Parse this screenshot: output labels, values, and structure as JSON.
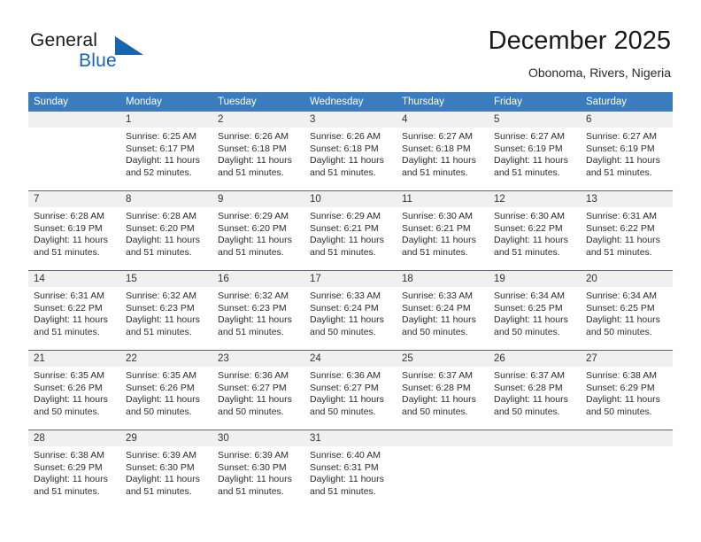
{
  "brand": {
    "name_part1": "General",
    "name_part2": "Blue",
    "logo_icon": "blue-triangle-icon",
    "accent_color": "#1565b0"
  },
  "header": {
    "month_title": "December 2025",
    "location": "Obonoma, Rivers, Nigeria"
  },
  "calendar": {
    "header_bg_color": "#3a7cbe",
    "daynum_band_color": "#f0f0f0",
    "week_separator_color": "#2f6fa8",
    "weekday_headers": [
      "Sunday",
      "Monday",
      "Tuesday",
      "Wednesday",
      "Thursday",
      "Friday",
      "Saturday"
    ],
    "weeks": [
      [
        {
          "day": "",
          "sunrise": "",
          "sunset": "",
          "daylight_line1": "",
          "daylight_line2": ""
        },
        {
          "day": "1",
          "sunrise": "Sunrise: 6:25 AM",
          "sunset": "Sunset: 6:17 PM",
          "daylight_line1": "Daylight: 11 hours",
          "daylight_line2": "and 52 minutes."
        },
        {
          "day": "2",
          "sunrise": "Sunrise: 6:26 AM",
          "sunset": "Sunset: 6:18 PM",
          "daylight_line1": "Daylight: 11 hours",
          "daylight_line2": "and 51 minutes."
        },
        {
          "day": "3",
          "sunrise": "Sunrise: 6:26 AM",
          "sunset": "Sunset: 6:18 PM",
          "daylight_line1": "Daylight: 11 hours",
          "daylight_line2": "and 51 minutes."
        },
        {
          "day": "4",
          "sunrise": "Sunrise: 6:27 AM",
          "sunset": "Sunset: 6:18 PM",
          "daylight_line1": "Daylight: 11 hours",
          "daylight_line2": "and 51 minutes."
        },
        {
          "day": "5",
          "sunrise": "Sunrise: 6:27 AM",
          "sunset": "Sunset: 6:19 PM",
          "daylight_line1": "Daylight: 11 hours",
          "daylight_line2": "and 51 minutes."
        },
        {
          "day": "6",
          "sunrise": "Sunrise: 6:27 AM",
          "sunset": "Sunset: 6:19 PM",
          "daylight_line1": "Daylight: 11 hours",
          "daylight_line2": "and 51 minutes."
        }
      ],
      [
        {
          "day": "7",
          "sunrise": "Sunrise: 6:28 AM",
          "sunset": "Sunset: 6:19 PM",
          "daylight_line1": "Daylight: 11 hours",
          "daylight_line2": "and 51 minutes."
        },
        {
          "day": "8",
          "sunrise": "Sunrise: 6:28 AM",
          "sunset": "Sunset: 6:20 PM",
          "daylight_line1": "Daylight: 11 hours",
          "daylight_line2": "and 51 minutes."
        },
        {
          "day": "9",
          "sunrise": "Sunrise: 6:29 AM",
          "sunset": "Sunset: 6:20 PM",
          "daylight_line1": "Daylight: 11 hours",
          "daylight_line2": "and 51 minutes."
        },
        {
          "day": "10",
          "sunrise": "Sunrise: 6:29 AM",
          "sunset": "Sunset: 6:21 PM",
          "daylight_line1": "Daylight: 11 hours",
          "daylight_line2": "and 51 minutes."
        },
        {
          "day": "11",
          "sunrise": "Sunrise: 6:30 AM",
          "sunset": "Sunset: 6:21 PM",
          "daylight_line1": "Daylight: 11 hours",
          "daylight_line2": "and 51 minutes."
        },
        {
          "day": "12",
          "sunrise": "Sunrise: 6:30 AM",
          "sunset": "Sunset: 6:22 PM",
          "daylight_line1": "Daylight: 11 hours",
          "daylight_line2": "and 51 minutes."
        },
        {
          "day": "13",
          "sunrise": "Sunrise: 6:31 AM",
          "sunset": "Sunset: 6:22 PM",
          "daylight_line1": "Daylight: 11 hours",
          "daylight_line2": "and 51 minutes."
        }
      ],
      [
        {
          "day": "14",
          "sunrise": "Sunrise: 6:31 AM",
          "sunset": "Sunset: 6:22 PM",
          "daylight_line1": "Daylight: 11 hours",
          "daylight_line2": "and 51 minutes."
        },
        {
          "day": "15",
          "sunrise": "Sunrise: 6:32 AM",
          "sunset": "Sunset: 6:23 PM",
          "daylight_line1": "Daylight: 11 hours",
          "daylight_line2": "and 51 minutes."
        },
        {
          "day": "16",
          "sunrise": "Sunrise: 6:32 AM",
          "sunset": "Sunset: 6:23 PM",
          "daylight_line1": "Daylight: 11 hours",
          "daylight_line2": "and 51 minutes."
        },
        {
          "day": "17",
          "sunrise": "Sunrise: 6:33 AM",
          "sunset": "Sunset: 6:24 PM",
          "daylight_line1": "Daylight: 11 hours",
          "daylight_line2": "and 50 minutes."
        },
        {
          "day": "18",
          "sunrise": "Sunrise: 6:33 AM",
          "sunset": "Sunset: 6:24 PM",
          "daylight_line1": "Daylight: 11 hours",
          "daylight_line2": "and 50 minutes."
        },
        {
          "day": "19",
          "sunrise": "Sunrise: 6:34 AM",
          "sunset": "Sunset: 6:25 PM",
          "daylight_line1": "Daylight: 11 hours",
          "daylight_line2": "and 50 minutes."
        },
        {
          "day": "20",
          "sunrise": "Sunrise: 6:34 AM",
          "sunset": "Sunset: 6:25 PM",
          "daylight_line1": "Daylight: 11 hours",
          "daylight_line2": "and 50 minutes."
        }
      ],
      [
        {
          "day": "21",
          "sunrise": "Sunrise: 6:35 AM",
          "sunset": "Sunset: 6:26 PM",
          "daylight_line1": "Daylight: 11 hours",
          "daylight_line2": "and 50 minutes."
        },
        {
          "day": "22",
          "sunrise": "Sunrise: 6:35 AM",
          "sunset": "Sunset: 6:26 PM",
          "daylight_line1": "Daylight: 11 hours",
          "daylight_line2": "and 50 minutes."
        },
        {
          "day": "23",
          "sunrise": "Sunrise: 6:36 AM",
          "sunset": "Sunset: 6:27 PM",
          "daylight_line1": "Daylight: 11 hours",
          "daylight_line2": "and 50 minutes."
        },
        {
          "day": "24",
          "sunrise": "Sunrise: 6:36 AM",
          "sunset": "Sunset: 6:27 PM",
          "daylight_line1": "Daylight: 11 hours",
          "daylight_line2": "and 50 minutes."
        },
        {
          "day": "25",
          "sunrise": "Sunrise: 6:37 AM",
          "sunset": "Sunset: 6:28 PM",
          "daylight_line1": "Daylight: 11 hours",
          "daylight_line2": "and 50 minutes."
        },
        {
          "day": "26",
          "sunrise": "Sunrise: 6:37 AM",
          "sunset": "Sunset: 6:28 PM",
          "daylight_line1": "Daylight: 11 hours",
          "daylight_line2": "and 50 minutes."
        },
        {
          "day": "27",
          "sunrise": "Sunrise: 6:38 AM",
          "sunset": "Sunset: 6:29 PM",
          "daylight_line1": "Daylight: 11 hours",
          "daylight_line2": "and 50 minutes."
        }
      ],
      [
        {
          "day": "28",
          "sunrise": "Sunrise: 6:38 AM",
          "sunset": "Sunset: 6:29 PM",
          "daylight_line1": "Daylight: 11 hours",
          "daylight_line2": "and 51 minutes."
        },
        {
          "day": "29",
          "sunrise": "Sunrise: 6:39 AM",
          "sunset": "Sunset: 6:30 PM",
          "daylight_line1": "Daylight: 11 hours",
          "daylight_line2": "and 51 minutes."
        },
        {
          "day": "30",
          "sunrise": "Sunrise: 6:39 AM",
          "sunset": "Sunset: 6:30 PM",
          "daylight_line1": "Daylight: 11 hours",
          "daylight_line2": "and 51 minutes."
        },
        {
          "day": "31",
          "sunrise": "Sunrise: 6:40 AM",
          "sunset": "Sunset: 6:31 PM",
          "daylight_line1": "Daylight: 11 hours",
          "daylight_line2": "and 51 minutes."
        },
        {
          "day": "",
          "sunrise": "",
          "sunset": "",
          "daylight_line1": "",
          "daylight_line2": ""
        },
        {
          "day": "",
          "sunrise": "",
          "sunset": "",
          "daylight_line1": "",
          "daylight_line2": ""
        },
        {
          "day": "",
          "sunrise": "",
          "sunset": "",
          "daylight_line1": "",
          "daylight_line2": ""
        }
      ]
    ]
  }
}
